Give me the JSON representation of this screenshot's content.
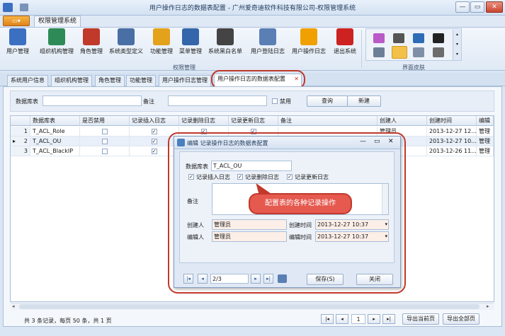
{
  "window": {
    "title": "用户操作日志的数据表配置 - 广州爱奇迪软件科技有限公司-权限管理系统",
    "min": "—",
    "max": "▭",
    "close": "✕"
  },
  "ribbon": {
    "file_label": "▭▾",
    "tab": "权限管理系统",
    "buttons": [
      "用户管理",
      "组织机构管理",
      "角色管理",
      "系统类型定义",
      "功能管理",
      "菜单管理",
      "系统黑白名单",
      "用户登陆日志",
      "用户操作日志",
      "退出系统"
    ],
    "group_label": "权限管理",
    "skin_label": "界面皮肤",
    "colors": [
      "#3b6fc1",
      "#2e8b57",
      "#c0392b",
      "#4a6fa5",
      "#e4a11b",
      "#3366aa",
      "#444444",
      "#5a7fb5",
      "#f0a000",
      "#cc2222"
    ]
  },
  "doc_tabs": [
    "系统用户信息",
    "组织机构管理",
    "角色管理",
    "功能管理",
    "用户操作日志管理",
    "用户操作日志的数据表配置"
  ],
  "doc_tab_close": "✕",
  "search": {
    "table_label": "数据库表",
    "remark_label": "备注",
    "disabled_label": "禁用",
    "query": "查询",
    "new": "新建"
  },
  "grid": {
    "headers": [
      "数据库表",
      "是否禁用",
      "记录插入日志",
      "记录删除日志",
      "记录更新日志",
      "备注",
      "创建人",
      "创建时间",
      "编辑"
    ],
    "rows": [
      {
        "num": "1",
        "table": "T_ACL_Role",
        "disabled": false,
        "insert": true,
        "delete": true,
        "update": true,
        "remark": "",
        "creator": "管理员",
        "created": "2013-12-27 12...",
        "editor": "管理"
      },
      {
        "num": "2",
        "table": "T_ACL_OU",
        "disabled": false,
        "insert": true,
        "delete": true,
        "update": true,
        "remark": "",
        "creator": "",
        "created": "2013-12-27 10...",
        "editor": "管理"
      },
      {
        "num": "3",
        "table": "T_ACL_BlackIP",
        "disabled": false,
        "insert": true,
        "delete": true,
        "update": true,
        "remark": "",
        "creator": "",
        "created": "2013-12-26 11...",
        "editor": "管理"
      }
    ],
    "current_marker": "▸"
  },
  "status": {
    "text": "共 3 条记录，每页 50 条，共 1 页",
    "page": "1",
    "export_current": "导出当前页",
    "export_all": "导出全部页"
  },
  "dialog": {
    "title": "编辑 记录操作日志的数据表配置",
    "table_label": "数据库表",
    "table_value": "T_ACL_OU",
    "cb_insert": "记录插入日志",
    "cb_delete": "记录删除日志",
    "cb_update": "记录更新日志",
    "remark_label": "备注",
    "creator_label": "创建人",
    "creator_value": "管理员",
    "created_label": "创建时间",
    "created_value": "2013-12-27 10:37",
    "editor_label": "编辑人",
    "editor_value": "管理员",
    "edited_label": "编辑时间",
    "edited_value": "2013-12-27 10:37",
    "page": "2/3",
    "save": "保存(S)",
    "close": "关闭"
  },
  "callout": "配置表的各种记录操作"
}
